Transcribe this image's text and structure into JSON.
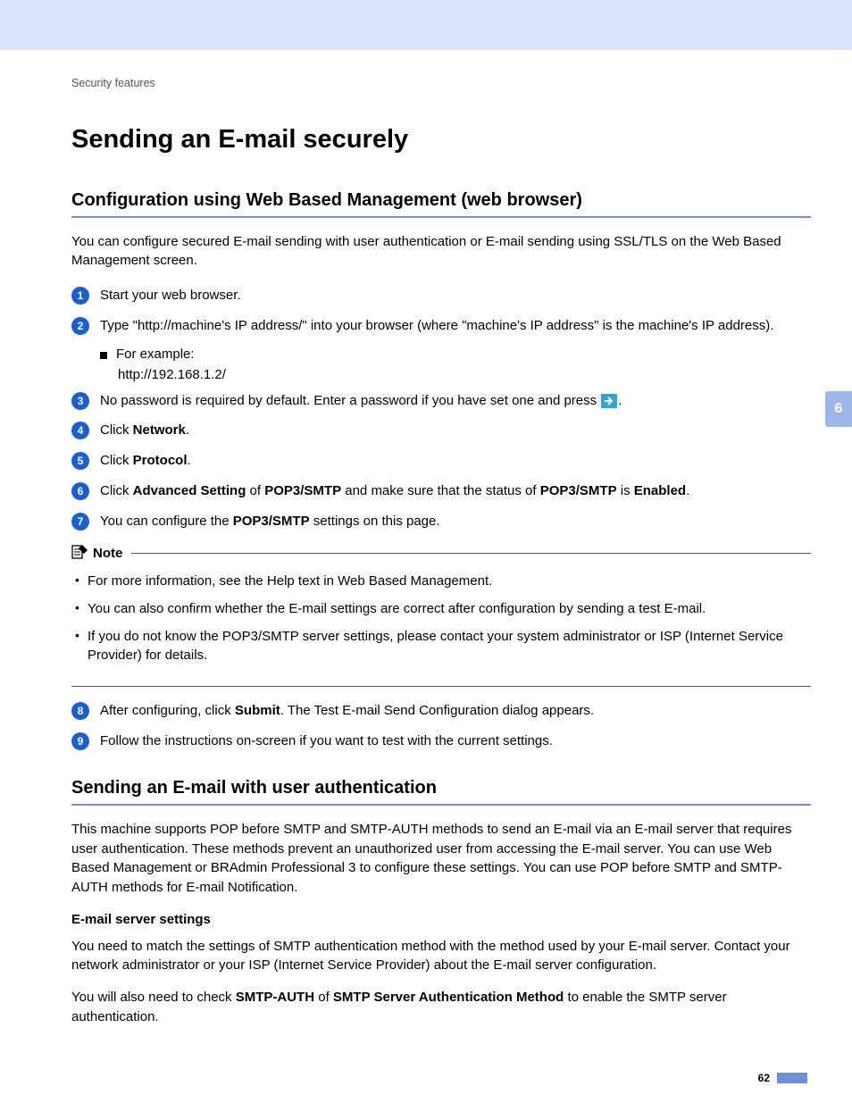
{
  "breadcrumb": "Security features",
  "h1": "Sending an E-mail securely",
  "section1": {
    "title": "Configuration using Web Based Management (web browser)",
    "intro": "You can configure secured E-mail sending with user authentication or E-mail sending using SSL/TLS on the Web Based Management screen.",
    "steps": {
      "s1": "Start your web browser.",
      "s2": "Type \"http://machine's IP address/\" into your browser (where \"machine's IP address\" is the machine's IP address).",
      "s2_sub_label": "For example:",
      "s2_sub_value": "http://192.168.1.2/",
      "s3_a": "No password is required by default. Enter a password if you have set one and press ",
      "s3_b": ".",
      "s4_a": "Click ",
      "s4_b": "Network",
      "s4_c": ".",
      "s5_a": "Click ",
      "s5_b": "Protocol",
      "s5_c": ".",
      "s6_a": "Click ",
      "s6_b": "Advanced Setting",
      "s6_c": " of ",
      "s6_d": "POP3/SMTP",
      "s6_e": " and make sure that the status of ",
      "s6_f": "POP3/SMTP",
      "s6_g": " is ",
      "s6_h": "Enabled",
      "s6_i": ".",
      "s7_a": "You can configure the ",
      "s7_b": "POP3/SMTP",
      "s7_c": " settings on this page.",
      "s8_a": "After configuring, click ",
      "s8_b": "Submit",
      "s8_c": ". The Test E-mail Send Configuration dialog appears.",
      "s9": "Follow the instructions on-screen if you want to test with the current settings."
    },
    "note_label": "Note",
    "note_items": {
      "n1": "For more information, see the Help text in Web Based Management.",
      "n2": "You can also confirm whether the E-mail settings are correct after configuration by sending a test E-mail.",
      "n3": "If you do not know the POP3/SMTP server settings, please contact your system administrator or ISP (Internet Service Provider) for details."
    }
  },
  "section2": {
    "title": "Sending an E-mail with user authentication",
    "p1": "This machine supports POP before SMTP and SMTP-AUTH methods to send an E-mail via an E-mail server that requires user authentication. These methods prevent an unauthorized user from accessing the E-mail server. You can use Web Based Management or BRAdmin Professional 3 to configure these settings. You can use POP before SMTP and SMTP-AUTH methods for E-mail Notification.",
    "sub_heading": "E-mail server settings",
    "p2": "You need to match the settings of SMTP authentication method with the method used by your E-mail server. Contact your network administrator or your ISP (Internet Service Provider) about the E-mail server configuration.",
    "p3_a": "You will also need to check ",
    "p3_b": "SMTP-AUTH",
    "p3_c": " of ",
    "p3_d": "SMTP Server Authentication Method",
    "p3_e": " to enable the SMTP server authentication."
  },
  "side_tab": "6",
  "page_number": "62"
}
